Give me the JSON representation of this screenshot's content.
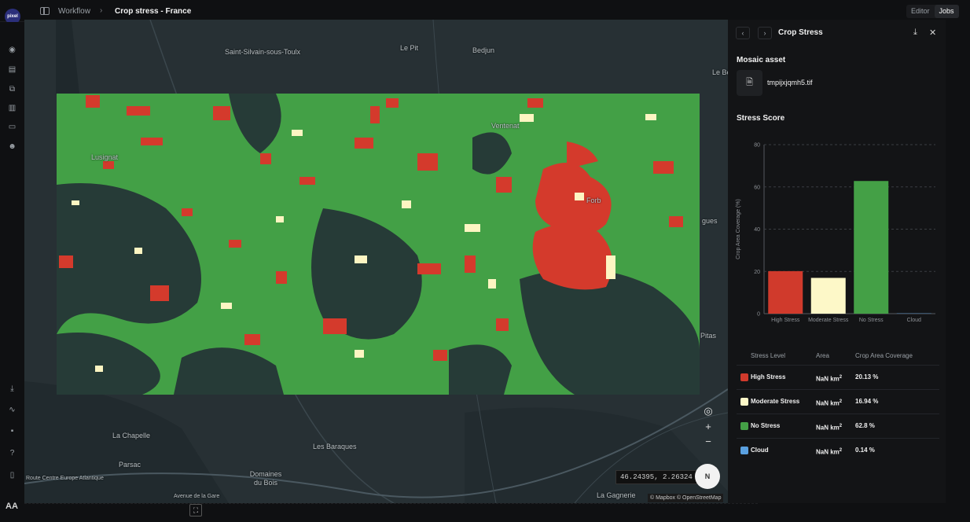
{
  "app": {
    "logo_text": "pixel"
  },
  "breadcrumb": {
    "parent": "Workflow",
    "separator": "›",
    "current": "Crop stress - France"
  },
  "mode_tabs": [
    {
      "label": "Editor",
      "active": false
    },
    {
      "label": "Jobs",
      "active": true
    }
  ],
  "rail": {
    "top_icons": [
      "explore-icon",
      "map-icon",
      "workflow-icon",
      "store-icon",
      "inbox-icon",
      "team-icon"
    ],
    "bottom_icons": [
      "download-icon",
      "activity-icon",
      "chat-icon",
      "help-icon",
      "docs-icon"
    ],
    "user_initials": "AA"
  },
  "map": {
    "place_labels": [
      "Saint-Silvain-sous-Toulx",
      "Le Pit",
      "Bedjun",
      "Le Bé",
      "Ventenat",
      "Lusignat",
      "Forb",
      "gues",
      "Pitas",
      "La Chapelle",
      "Les Baraques",
      "Parsac",
      "Domaines du Bois",
      "La Gagnerie",
      "Avenue de la Gare",
      "Route Centre Europe Atlantique"
    ],
    "coordinates": "46.24395, 2.26324",
    "attribution": "© Mapbox © OpenStreetMap",
    "compass_label": "N",
    "controls": {
      "locate": "◎",
      "zoom_in": "+",
      "zoom_out": "−"
    },
    "fullscreen_icon": "⛶",
    "colors": {
      "high": "#d43a2c",
      "moderate": "#fdf5c2",
      "none": "#44a046",
      "cloud": "#5aa0e0",
      "base": "#243136"
    }
  },
  "panel": {
    "title": "Crop Stress",
    "prev": "‹",
    "next": "›",
    "download_icon": "⤓",
    "close_icon": "✕",
    "asset_heading": "Mosaic asset",
    "asset_file": "tmpijxjqmh5.tif",
    "file_icon": "🗎",
    "score_heading": "Stress Score"
  },
  "chart_data": {
    "type": "bar",
    "title": "",
    "ylabel": "Crop Area Coverage (%)",
    "xlabel": "",
    "categories": [
      "High Stress",
      "Moderate Stress",
      "No Stress",
      "Cloud"
    ],
    "values": [
      20.13,
      16.94,
      62.8,
      0.14
    ],
    "colors": [
      "#d03a2c",
      "#fdf8c8",
      "#44a046",
      "#5aa0e0"
    ],
    "yticks": [
      0,
      20,
      40,
      60,
      80
    ],
    "ylim": [
      0,
      80
    ],
    "grid": true
  },
  "table": {
    "headers": [
      "Stress Level",
      "Area",
      "Crop Area Coverage"
    ],
    "rows": [
      {
        "level": "High Stress",
        "area": "NaN km",
        "area_sup": "2",
        "coverage": "20.13 %",
        "color": "#d03a2c"
      },
      {
        "level": "Moderate Stress",
        "area": "NaN km",
        "area_sup": "2",
        "coverage": "16.94 %",
        "color": "#fdf8c8"
      },
      {
        "level": "No Stress",
        "area": "NaN km",
        "area_sup": "2",
        "coverage": "62.8 %",
        "color": "#44a046"
      },
      {
        "level": "Cloud",
        "area": "NaN km",
        "area_sup": "2",
        "coverage": "0.14 %",
        "color": "#5aa0e0"
      }
    ]
  }
}
